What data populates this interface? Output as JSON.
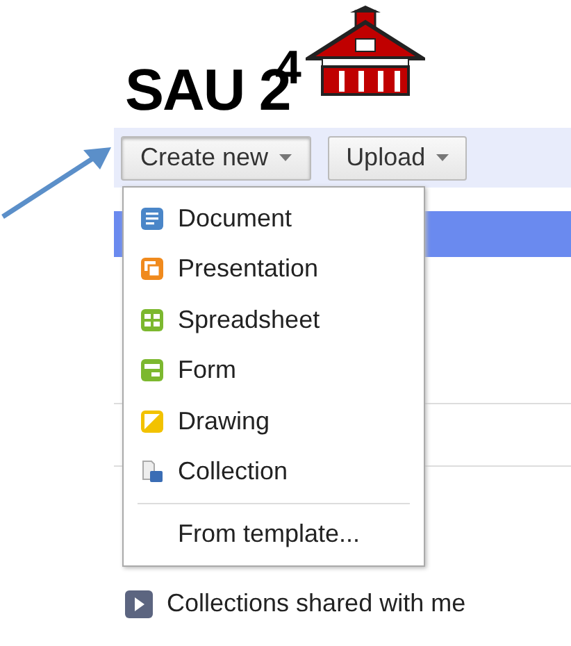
{
  "logo": {
    "text": "SAU 2",
    "superscript": "4"
  },
  "toolbar": [
    {
      "label": "Create new",
      "expanded": true
    },
    {
      "label": "Upload",
      "expanded": false
    }
  ],
  "menu": {
    "items": [
      {
        "label": "Document",
        "kind": "document"
      },
      {
        "label": "Presentation",
        "kind": "presentation"
      },
      {
        "label": "Spreadsheet",
        "kind": "spreadsheet"
      },
      {
        "label": "Form",
        "kind": "form"
      },
      {
        "label": "Drawing",
        "kind": "drawing"
      },
      {
        "label": "Collection",
        "kind": "collection"
      }
    ],
    "footer": "From template..."
  },
  "sidebar": {
    "shared": "Collections shared with me"
  }
}
